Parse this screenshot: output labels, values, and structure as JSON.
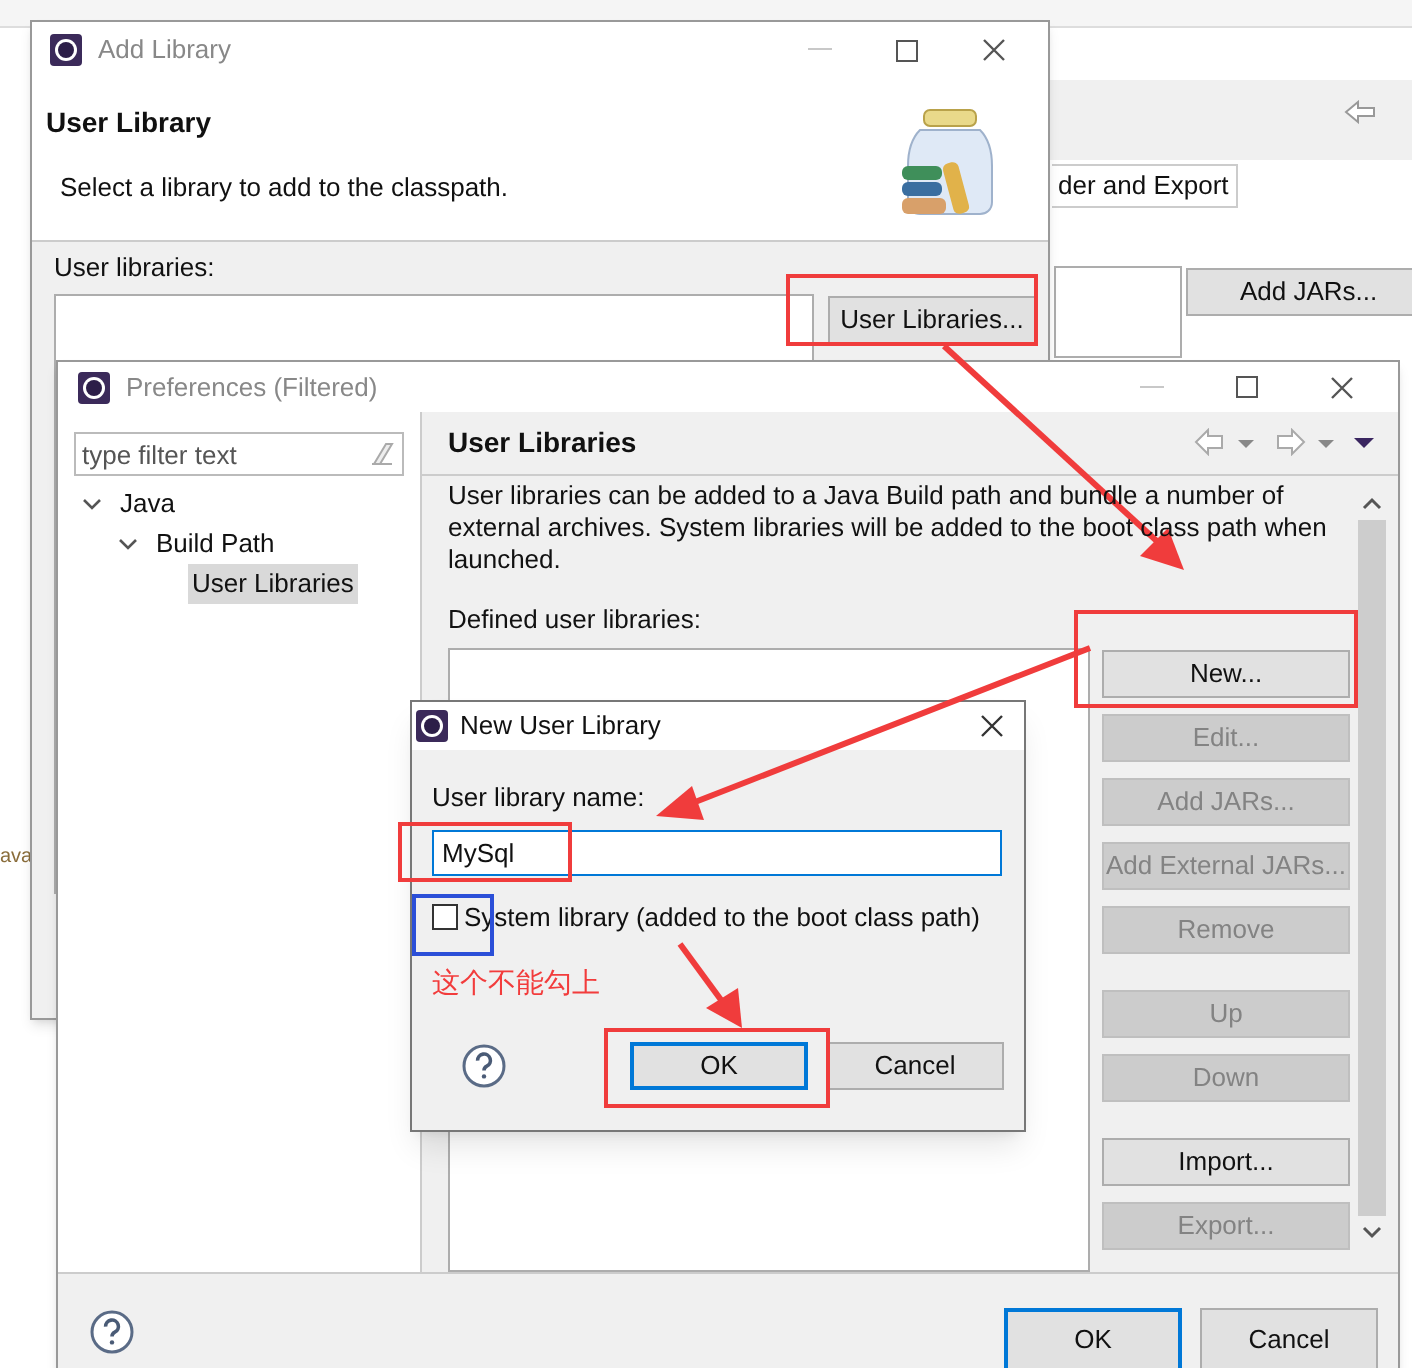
{
  "background_window": {
    "tab": "der and Export",
    "buttons": [
      "Add JARs..."
    ],
    "side_text": "ava"
  },
  "add_library": {
    "title": "Add Library",
    "heading": "User Library",
    "description": "Select a library to add to the classpath.",
    "list_label": "User libraries:",
    "button": "User Libraries..."
  },
  "preferences": {
    "title": "Preferences (Filtered)",
    "filter_placeholder": "type filter text",
    "tree": [
      {
        "label": "Java",
        "expanded": true,
        "selected": false,
        "children": [
          {
            "label": "Build Path",
            "expanded": true,
            "selected": false,
            "children": [
              {
                "label": "User Libraries",
                "selected": false,
                "highlighted": true
              }
            ]
          }
        ]
      }
    ],
    "page_title": "User Libraries",
    "description": "User libraries can be added to a Java Build path and bundle a number of external archives. System libraries will be added to the boot class path when launched.",
    "list_label": "Defined user libraries:",
    "button_groups": [
      [
        {
          "label": "New...",
          "disabled": false
        },
        {
          "label": "Edit...",
          "disabled": true
        },
        {
          "label": "Add JARs...",
          "disabled": true
        },
        {
          "label": "Add External JARs...",
          "disabled": true
        },
        {
          "label": "Remove",
          "disabled": true
        }
      ],
      [
        {
          "label": "Up",
          "disabled": true
        },
        {
          "label": "Down",
          "disabled": true
        }
      ],
      [
        {
          "label": "Import...",
          "disabled": false
        },
        {
          "label": "Export...",
          "disabled": true
        }
      ]
    ],
    "footer_buttons": [
      {
        "label": "OK",
        "default": true
      },
      {
        "label": "Cancel",
        "default": false
      }
    ]
  },
  "new_user_library": {
    "title": "New User Library",
    "name_label": "User library name:",
    "name_value": "MySql",
    "checkbox": {
      "label": "System library (added to the boot class path)",
      "checked": false
    },
    "buttons": [
      {
        "label": "OK",
        "default": true
      },
      {
        "label": "Cancel",
        "default": false
      }
    ]
  },
  "annotation": "这个不能勾上"
}
